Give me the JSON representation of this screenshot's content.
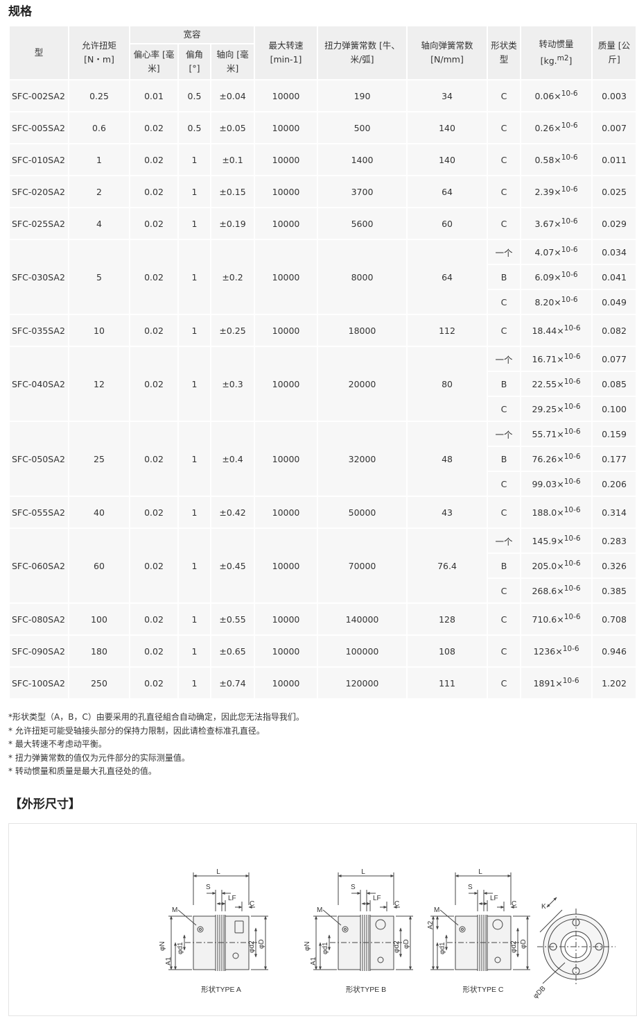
{
  "specs_title": "规格",
  "headers": {
    "model": "型",
    "torque": "允许扭矩 [N・m]",
    "tolerance": "宽容",
    "eccentricity": "偏心率 [毫米]",
    "angle": "偏角 [°]",
    "axial": "轴向 [毫米]",
    "max_speed": "最大转速 [min-1]",
    "torsional_spring": "扭力弹簧常数 [牛、米/弧]",
    "axial_spring": "轴向弹簧常数 [N/mm]",
    "shape_type": "形状类型",
    "inertia_prefix": "转动惯量 [kg.",
    "inertia_unit": "m2",
    "inertia_suffix": "]",
    "mass": "质量 [公斤]"
  },
  "inertia_exp": "10-6",
  "rows": [
    {
      "model": "SFC-002SA2",
      "torque": "0.25",
      "ecc": "0.01",
      "angle": "0.5",
      "axial": "±0.04",
      "speed": "10000",
      "tspring": "190",
      "aspring": "34",
      "variants": [
        {
          "type": "C",
          "inertia": "0.06×",
          "mass": "0.003"
        }
      ]
    },
    {
      "model": "SFC-005SA2",
      "torque": "0.6",
      "ecc": "0.02",
      "angle": "0.5",
      "axial": "±0.05",
      "speed": "10000",
      "tspring": "500",
      "aspring": "140",
      "variants": [
        {
          "type": "C",
          "inertia": "0.26×",
          "mass": "0.007"
        }
      ]
    },
    {
      "model": "SFC-010SA2",
      "torque": "1",
      "ecc": "0.02",
      "angle": "1",
      "axial": "±0.1",
      "speed": "10000",
      "tspring": "1400",
      "aspring": "140",
      "variants": [
        {
          "type": "C",
          "inertia": "0.58×",
          "mass": "0.011"
        }
      ]
    },
    {
      "model": "SFC-020SA2",
      "torque": "2",
      "ecc": "0.02",
      "angle": "1",
      "axial": "±0.15",
      "speed": "10000",
      "tspring": "3700",
      "aspring": "64",
      "variants": [
        {
          "type": "C",
          "inertia": "2.39×",
          "mass": "0.025"
        }
      ]
    },
    {
      "model": "SFC-025SA2",
      "torque": "4",
      "ecc": "0.02",
      "angle": "1",
      "axial": "±0.19",
      "speed": "10000",
      "tspring": "5600",
      "aspring": "60",
      "variants": [
        {
          "type": "C",
          "inertia": "3.67×",
          "mass": "0.029"
        }
      ]
    },
    {
      "model": "SFC-030SA2",
      "torque": "5",
      "ecc": "0.02",
      "angle": "1",
      "axial": "±0.2",
      "speed": "10000",
      "tspring": "8000",
      "aspring": "64",
      "variants": [
        {
          "type": "一个",
          "inertia": "4.07×",
          "mass": "0.034"
        },
        {
          "type": "B",
          "inertia": "6.09×",
          "mass": "0.041"
        },
        {
          "type": "C",
          "inertia": "8.20×",
          "mass": "0.049"
        }
      ]
    },
    {
      "model": "SFC-035SA2",
      "torque": "10",
      "ecc": "0.02",
      "angle": "1",
      "axial": "±0.25",
      "speed": "10000",
      "tspring": "18000",
      "aspring": "112",
      "variants": [
        {
          "type": "C",
          "inertia": "18.44×",
          "mass": "0.082"
        }
      ]
    },
    {
      "model": "SFC-040SA2",
      "torque": "12",
      "ecc": "0.02",
      "angle": "1",
      "axial": "±0.3",
      "speed": "10000",
      "tspring": "20000",
      "aspring": "80",
      "variants": [
        {
          "type": "一个",
          "inertia": "16.71×",
          "mass": "0.077"
        },
        {
          "type": "B",
          "inertia": "22.55×",
          "mass": "0.085"
        },
        {
          "type": "C",
          "inertia": "29.25×",
          "mass": "0.100"
        }
      ]
    },
    {
      "model": "SFC-050SA2",
      "torque": "25",
      "ecc": "0.02",
      "angle": "1",
      "axial": "±0.4",
      "speed": "10000",
      "tspring": "32000",
      "aspring": "48",
      "variants": [
        {
          "type": "一个",
          "inertia": "55.71×",
          "mass": "0.159"
        },
        {
          "type": "B",
          "inertia": "76.26×",
          "mass": "0.177"
        },
        {
          "type": "C",
          "inertia": "99.03×",
          "mass": "0.206"
        }
      ]
    },
    {
      "model": "SFC-055SA2",
      "torque": "40",
      "ecc": "0.02",
      "angle": "1",
      "axial": "±0.42",
      "speed": "10000",
      "tspring": "50000",
      "aspring": "43",
      "variants": [
        {
          "type": "C",
          "inertia": "188.0×",
          "mass": "0.314"
        }
      ]
    },
    {
      "model": "SFC-060SA2",
      "torque": "60",
      "ecc": "0.02",
      "angle": "1",
      "axial": "±0.45",
      "speed": "10000",
      "tspring": "70000",
      "aspring": "76.4",
      "variants": [
        {
          "type": "一个",
          "inertia": "145.9×",
          "mass": "0.283"
        },
        {
          "type": "B",
          "inertia": "205.0×",
          "mass": "0.326"
        },
        {
          "type": "C",
          "inertia": "268.6×",
          "mass": "0.385"
        }
      ]
    },
    {
      "model": "SFC-080SA2",
      "torque": "100",
      "ecc": "0.02",
      "angle": "1",
      "axial": "±0.55",
      "speed": "10000",
      "tspring": "140000",
      "aspring": "128",
      "variants": [
        {
          "type": "C",
          "inertia": "710.6×",
          "mass": "0.708"
        }
      ]
    },
    {
      "model": "SFC-090SA2",
      "torque": "180",
      "ecc": "0.02",
      "angle": "1",
      "axial": "±0.65",
      "speed": "10000",
      "tspring": "100000",
      "aspring": "108",
      "variants": [
        {
          "type": "C",
          "inertia": "1236×",
          "mass": "0.946"
        }
      ]
    },
    {
      "model": "SFC-100SA2",
      "torque": "250",
      "ecc": "0.02",
      "angle": "1",
      "axial": "±0.74",
      "speed": "10000",
      "tspring": "120000",
      "aspring": "111",
      "variants": [
        {
          "type": "C",
          "inertia": "1891×",
          "mass": "1.202"
        }
      ]
    }
  ],
  "notes": [
    "*形状类型（A，B，C）由要采用的孔直径組合自动确定，因此您无法指导我们。",
    "* 允许扭矩可能受轴接头部分的保持力限制，因此请检查标准孔直径。",
    "* 最大转速不考虑动平衡。",
    "* 扭力弹簧常数的值仅为元件部分的实际测量值。",
    "* 转动惯量和质量是最大孔直径处的值。"
  ],
  "dims_title": "【外形尺寸】",
  "drawing": {
    "labels": {
      "L": "L",
      "S": "S",
      "LF": "LF",
      "C": "C",
      "M": "M",
      "N": "φN",
      "A1": "A1",
      "A2": "A2",
      "d1": "φd1",
      "d2": "φd2",
      "D": "φD",
      "K": "K",
      "DB": "φDB"
    },
    "type_a": "形状TYPE A",
    "type_b": "形状TYPE B",
    "type_c": "形状TYPE C"
  }
}
